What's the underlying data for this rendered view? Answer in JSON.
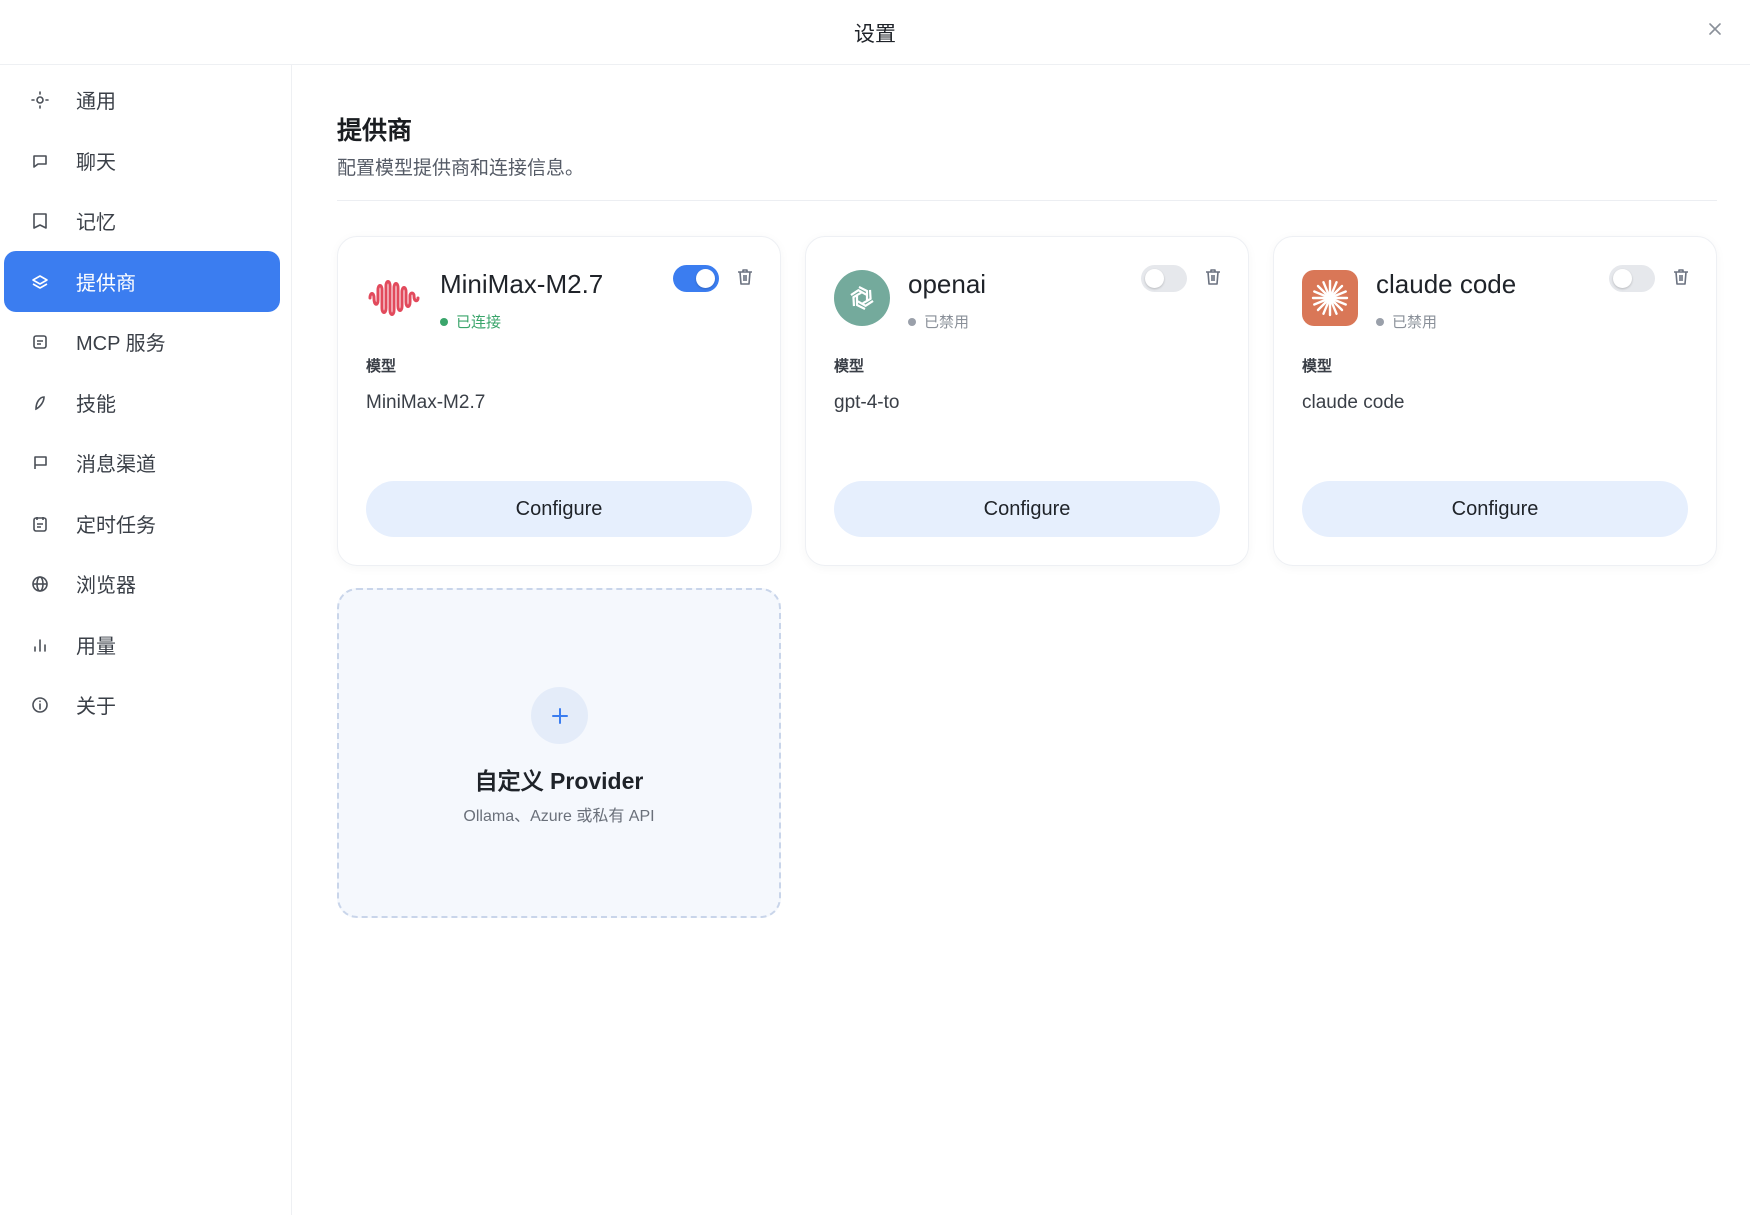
{
  "window": {
    "title": "设置"
  },
  "sidebar": {
    "items": [
      {
        "label": "通用",
        "icon": "sun-icon",
        "active": false
      },
      {
        "label": "聊天",
        "icon": "chat-bubble-icon",
        "active": false
      },
      {
        "label": "记忆",
        "icon": "book-icon",
        "active": false
      },
      {
        "label": "提供商",
        "icon": "layers-icon",
        "active": true
      },
      {
        "label": "MCP 服务",
        "icon": "server-icon",
        "active": false
      },
      {
        "label": "技能",
        "icon": "feather-icon",
        "active": false
      },
      {
        "label": "消息渠道",
        "icon": "message-flag-icon",
        "active": false
      },
      {
        "label": "定时任务",
        "icon": "calendar-icon",
        "active": false
      },
      {
        "label": "浏览器",
        "icon": "globe-icon",
        "active": false
      },
      {
        "label": "用量",
        "icon": "bar-chart-icon",
        "active": false
      },
      {
        "label": "关于",
        "icon": "info-icon",
        "active": false
      }
    ]
  },
  "main": {
    "title": "提供商",
    "description": "配置模型提供商和连接信息。",
    "providers": [
      {
        "name": "MiniMax-M2.7",
        "status": "已连接",
        "enabled": true,
        "model_label": "模型",
        "model": "MiniMax-M2.7",
        "button": "Configure",
        "logo": "minimax-wave-logo"
      },
      {
        "name": "openai",
        "status": "已禁用",
        "enabled": false,
        "model_label": "模型",
        "model": "gpt-4-to",
        "button": "Configure",
        "logo": "openai-logo"
      },
      {
        "name": "claude code",
        "status": "已禁用",
        "enabled": false,
        "model_label": "模型",
        "model": "claude code",
        "button": "Configure",
        "logo": "claude-sunburst-logo"
      }
    ],
    "add_provider": {
      "title": "自定义 Provider",
      "subtitle": "Ollama、Azure 或私有 API"
    }
  },
  "colors": {
    "accent": "#3b7df0",
    "connected": "#3aa56b",
    "disabled": "#9aa0aa",
    "button_bg": "#e6effd",
    "openai": "#74aa9c",
    "claude": "#d97757",
    "minimax": "#e24a5c"
  }
}
